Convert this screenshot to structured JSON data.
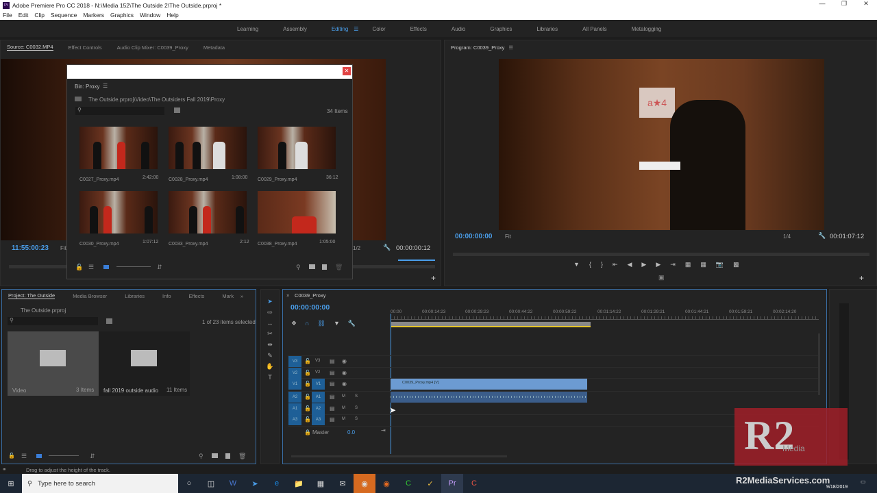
{
  "window": {
    "title": "Adobe Premiere Pro CC 2018 - N:\\Media 152\\The Outside 2\\The Outside.prproj *",
    "app_icon": "Pr"
  },
  "menu": [
    "File",
    "Edit",
    "Clip",
    "Sequence",
    "Markers",
    "Graphics",
    "Window",
    "Help"
  ],
  "workspaces": [
    {
      "label": "Learning"
    },
    {
      "label": "Assembly"
    },
    {
      "label": "Editing",
      "active": true
    },
    {
      "label": "Color"
    },
    {
      "label": "Effects"
    },
    {
      "label": "Audio"
    },
    {
      "label": "Graphics"
    },
    {
      "label": "Libraries"
    },
    {
      "label": "All Panels"
    },
    {
      "label": "Metalogging"
    }
  ],
  "source": {
    "tabs": [
      "Source: C0032.MP4",
      "Effect Controls",
      "Audio Clip Mixer: C0039_Proxy",
      "Metadata"
    ],
    "timecode": "11:55:00:23",
    "fit": "Fit",
    "res": "1/2",
    "duration": "00:00:00:12"
  },
  "bin": {
    "title": "Bin: Proxy",
    "path": "The Outside.prproj\\Video\\The Outsiders Fall 2019\\Proxy",
    "count": "34 Items",
    "items": [
      {
        "name": "C0027_Proxy.mp4",
        "dur": "2:42:00"
      },
      {
        "name": "C0028_Proxy.mp4",
        "dur": "1:08:00"
      },
      {
        "name": "C0029_Proxy.mp4",
        "dur": "36:12"
      },
      {
        "name": "C0030_Proxy.mp4",
        "dur": "1:07:12"
      },
      {
        "name": "C0033_Proxy.mp4",
        "dur": "2:12"
      },
      {
        "name": "C0038_Proxy.mp4",
        "dur": "1:05:00"
      }
    ]
  },
  "program": {
    "tab": "Program: C0039_Proxy",
    "timecode": "00:00:00:00",
    "fit": "Fit",
    "res": "1/4",
    "duration": "00:01:07:12",
    "sign_text": "a★4"
  },
  "project": {
    "tabs": [
      "Project: The Outside",
      "Media Browser",
      "Libraries",
      "Info",
      "Effects",
      "Mark"
    ],
    "file": "The Outside.prproj",
    "selection": "1 of 23 items selected",
    "items": [
      {
        "name": "Video",
        "count": "3 Items"
      },
      {
        "name": "fall 2019 outside audio",
        "count": "11 Items"
      }
    ]
  },
  "timeline": {
    "tab": "C0039_Proxy",
    "timecode": "00:00:00:00",
    "ruler": [
      "00:00",
      "00:00:14:23",
      "00:00:29:23",
      "00:00:44:22",
      "00:00:59:22",
      "00:01:14:22",
      "00:01:29:21",
      "00:01:44:21",
      "00:01:59:21",
      "00:02:14:20"
    ],
    "video_tracks": [
      {
        "src": "V3",
        "name": "V3"
      },
      {
        "src": "V2",
        "name": "V2"
      },
      {
        "src": "V1",
        "name": "V1"
      }
    ],
    "audio_tracks": [
      {
        "src": "A2",
        "name": "A1"
      },
      {
        "src": "A1",
        "name": "A2"
      },
      {
        "src": "A3",
        "name": "A3"
      }
    ],
    "master": "Master",
    "master_value": "0.0",
    "clip_label": "C0039_Proxy.mp4 [V]",
    "m": "M",
    "s": "S"
  },
  "status": "Drag to adjust the height of the track.",
  "taskbar": {
    "search_placeholder": "Type here to search",
    "date": "9/18/2019"
  },
  "watermark": {
    "logo": "R2",
    "sub": "Media",
    "url": "R2MediaServices.com"
  },
  "colors": {
    "accent": "#4a9eea",
    "track": "#1e5f97",
    "clip_video": "#6c9bd2",
    "clip_audio": "#3b5d8a",
    "workarea": "#e5c42a"
  }
}
